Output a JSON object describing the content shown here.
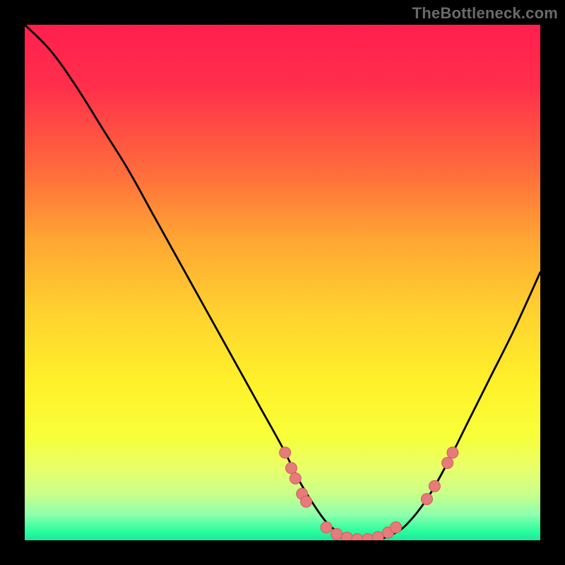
{
  "watermark": "TheBottleneck.com",
  "colors": {
    "dot_fill": "#e77a7a",
    "dot_stroke": "#d05d5d",
    "curve": "#000000"
  },
  "chart_data": {
    "type": "line",
    "title": "",
    "xlabel": "",
    "ylabel": "",
    "xlim": [
      0,
      100
    ],
    "ylim": [
      0,
      100
    ],
    "grid": false,
    "legend": null,
    "series": [
      {
        "name": "bottleneck-curve",
        "x": [
          0,
          5,
          10,
          15,
          20,
          25,
          30,
          35,
          40,
          45,
          50,
          53,
          56,
          59,
          62,
          65,
          68,
          71,
          74,
          78,
          82,
          86,
          90,
          95,
          100
        ],
        "y": [
          100,
          95,
          88,
          80,
          72,
          63,
          54,
          45,
          36,
          27,
          18,
          12,
          7,
          3,
          1,
          0,
          0,
          1,
          3,
          8,
          15,
          23,
          31,
          41,
          52
        ]
      }
    ],
    "markers": [
      {
        "x": 50.5,
        "y": 17
      },
      {
        "x": 51.7,
        "y": 14
      },
      {
        "x": 52.5,
        "y": 12
      },
      {
        "x": 53.8,
        "y": 9
      },
      {
        "x": 54.6,
        "y": 7.5
      },
      {
        "x": 58.5,
        "y": 2.5
      },
      {
        "x": 60.5,
        "y": 1.2
      },
      {
        "x": 62.5,
        "y": 0.5
      },
      {
        "x": 64.5,
        "y": 0.2
      },
      {
        "x": 66.5,
        "y": 0.2
      },
      {
        "x": 68.5,
        "y": 0.6
      },
      {
        "x": 70.5,
        "y": 1.5
      },
      {
        "x": 72.0,
        "y": 2.5
      },
      {
        "x": 78.0,
        "y": 8
      },
      {
        "x": 79.5,
        "y": 10.5
      },
      {
        "x": 82.0,
        "y": 15
      },
      {
        "x": 83.0,
        "y": 17
      }
    ],
    "marker_radius_px": 8
  }
}
